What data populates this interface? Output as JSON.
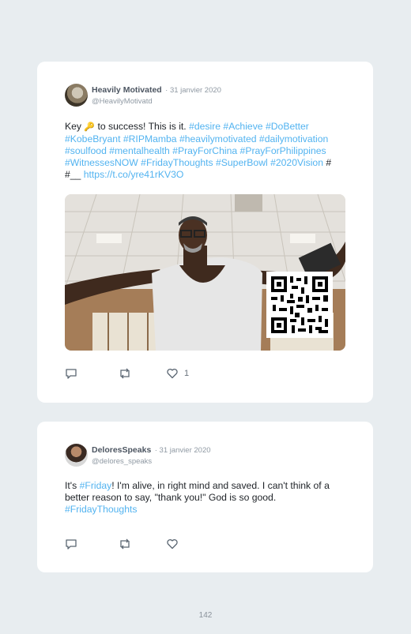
{
  "tweets": [
    {
      "display_name": "Heavily Motivated",
      "date": "· 31 janvier 2020",
      "handle": "@HeavilyMotivatd",
      "text": {
        "p1": "Key ",
        "key_emoji": "🔑",
        "p2": " to success! This is it. ",
        "tags_a": "#desire #Achieve #DoBetter #KobeBryant #RIPMamba #heavilymotivated #dailymotivation #soulfood #mentalhealth #PrayForChina #PrayForPhilippines #WitnessesNOW #FridayThoughts #SuperBowl #2020Vision",
        "plain": " # #__ ",
        "link": "https://t.co/yre41rKV3O"
      },
      "media_icon": "qr-code-icon",
      "likes": "1"
    },
    {
      "display_name": "DeloresSpeaks",
      "date": "· 31 janvier 2020",
      "handle": "@delores_speaks",
      "text": {
        "p1": "It's ",
        "tag1": "#Friday",
        "p2": "! I'm alive, in right mind and saved. I can't think of a better reason to say, \"thank you!\" God is so good. ",
        "tag2": "#FridayThoughts"
      },
      "likes": ""
    }
  ],
  "page_number": "142",
  "colors": {
    "hashtag": "#52b3f0",
    "background": "#e8edf0",
    "card": "#ffffff"
  }
}
